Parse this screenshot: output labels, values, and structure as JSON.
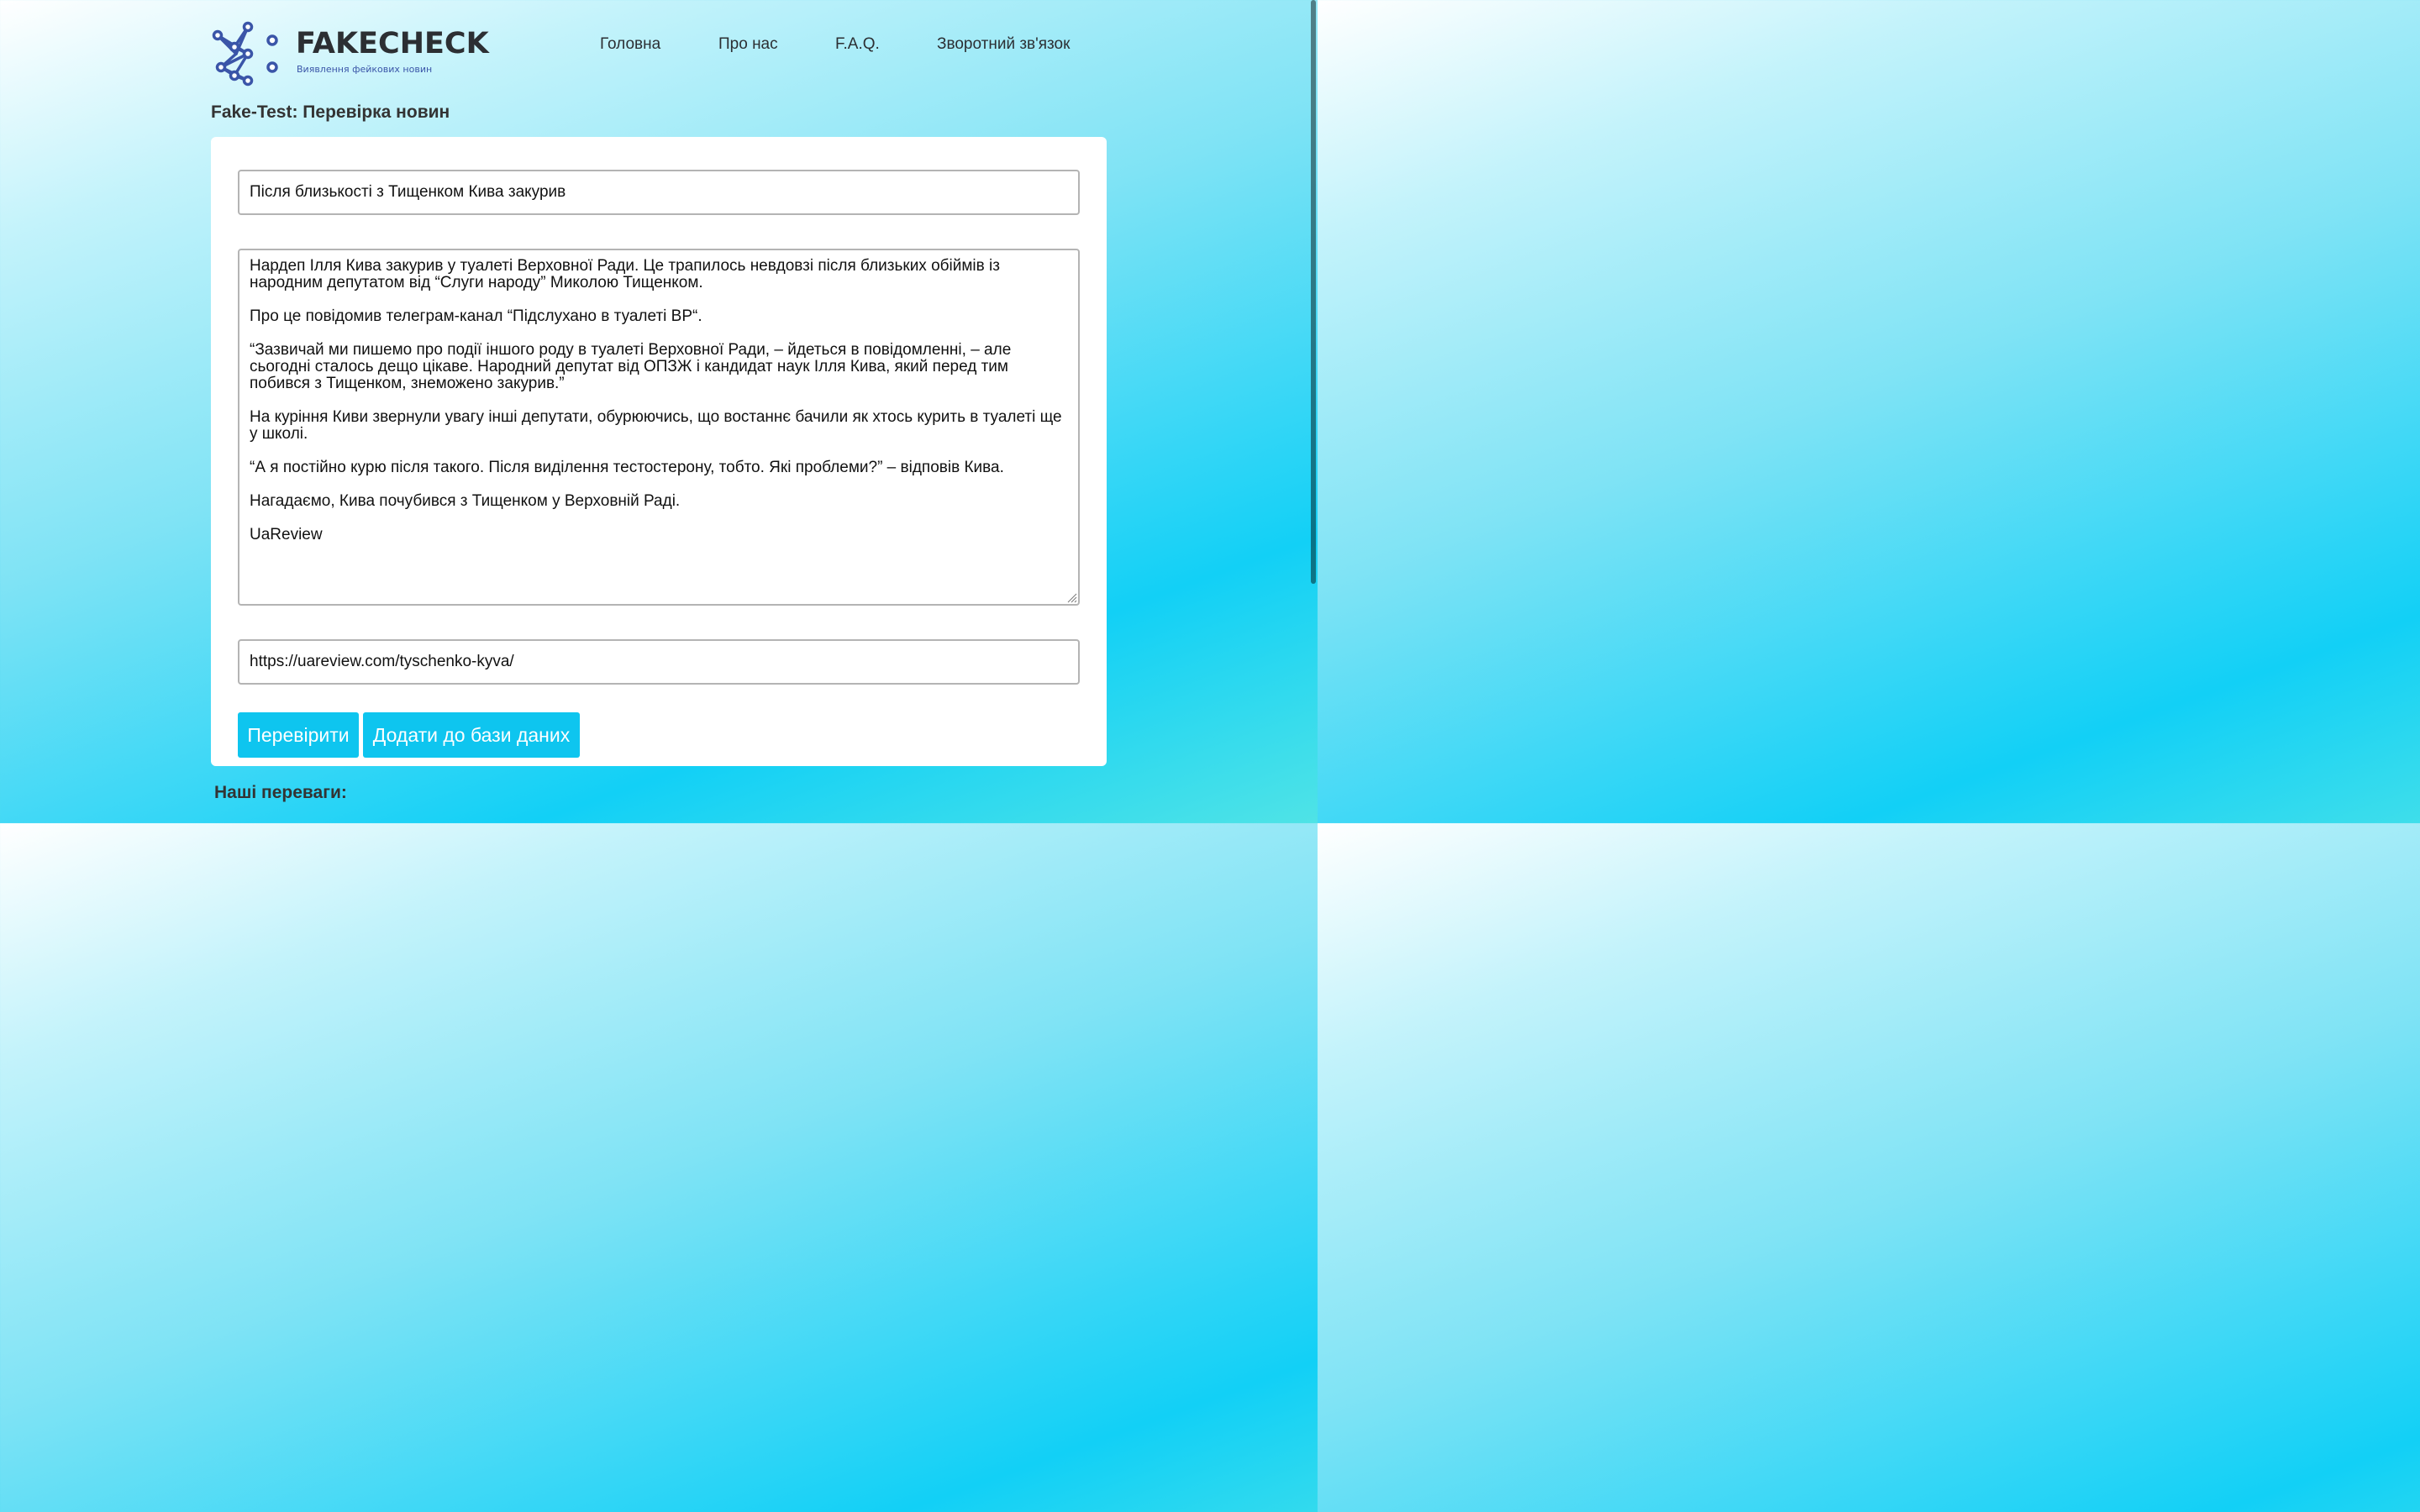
{
  "brand": {
    "name": "FAKECHECK",
    "tagline": "Виявлення фейкових новин",
    "logo_icon": "network-nodes-logo",
    "color_text": "#2c2f33",
    "color_accent": "#3a55a8"
  },
  "nav": {
    "items": [
      {
        "label": "Головна"
      },
      {
        "label": "Про нас"
      },
      {
        "label": "F.A.Q."
      },
      {
        "label": "Зворотний зв'язок"
      }
    ]
  },
  "page": {
    "title": "Fake-Test: Перевірка новин"
  },
  "form": {
    "headline_value": "Після близькості з Тищенком Кива закурив",
    "body_value": "Нардеп Ілля Кива закурив у туалеті Верховної Ради. Це трапилось невдовзі після близьких обіймів із народним депутатом від “Слуги народу” Миколою Тищенком.\n\nПро це повідомив телеграм-канал “Підслухано в туалеті ВР“.\n\n“Зазвичай ми пишемо про події іншого роду в туалеті Верховної Ради, – йдеться в повідомленні, – але сьогодні сталось дещо цікаве. Народний депутат від ОПЗЖ і кандидат наук Ілля Кива, який перед тим побився з Тищенком, знеможено закурив.”\n\nНа куріння Киви звернули увагу інші депутати, обурюючись, що востаннє бачили як хтось курить в туалеті ще у школі.\n\n“А я постійно курю після такого. Після виділення тестостерону, тобто. Які проблеми?” – відповів Кива.\n\nНагадаємо, Кива почубився з Тищенком у Верховній Раді.\n\nUaReview",
    "url_value": "https://uareview.com/tyschenko-kyva/",
    "check_button": "Перевірити",
    "add_button": "Додати до бази даних",
    "button_color": "#0ec5ef"
  },
  "advantages": {
    "heading": "Наші переваги:"
  }
}
